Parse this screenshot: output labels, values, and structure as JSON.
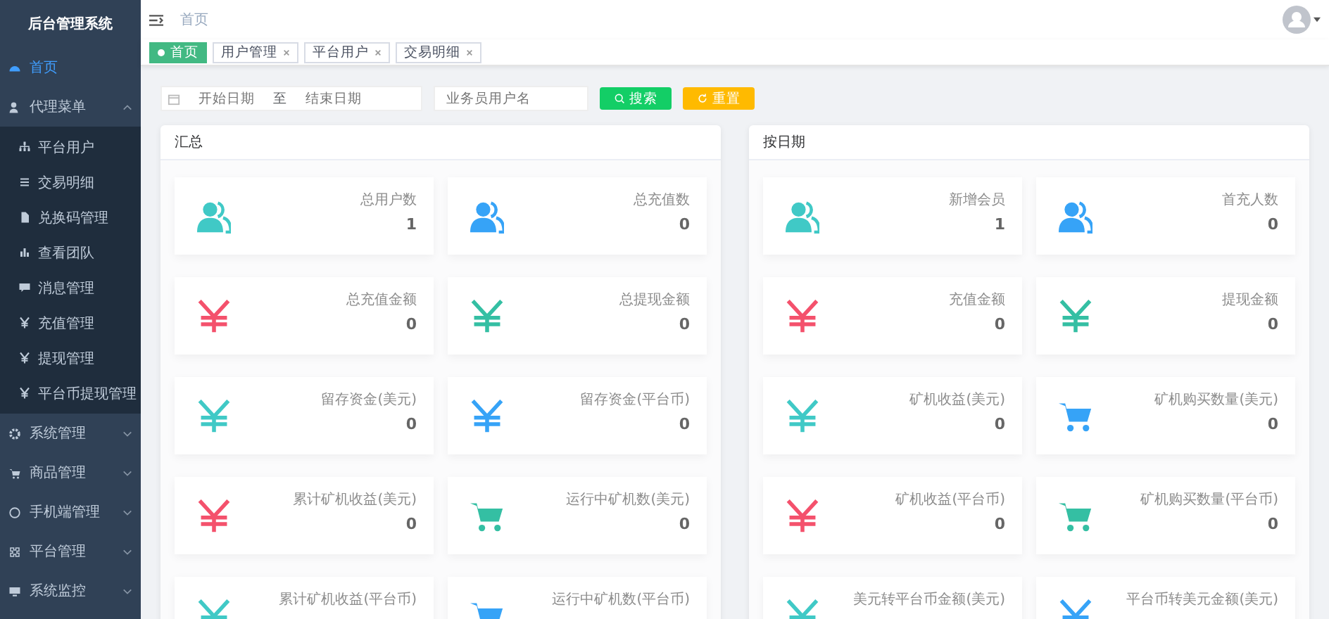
{
  "sidebar": {
    "title": "后台管理系统",
    "items": [
      {
        "label": "首页",
        "selected": true
      },
      {
        "label": "代理菜单",
        "selected": false,
        "expanded": true,
        "children": [
          {
            "label": "平台用户"
          },
          {
            "label": "交易明细"
          },
          {
            "label": "兑换码管理"
          },
          {
            "label": "查看团队"
          },
          {
            "label": "消息管理"
          },
          {
            "label": "充值管理"
          },
          {
            "label": "提现管理"
          },
          {
            "label": "平台币提现管理"
          }
        ]
      },
      {
        "label": "系统管理",
        "selected": false,
        "expanded": false
      },
      {
        "label": "商品管理",
        "selected": false,
        "expanded": false
      },
      {
        "label": "手机端管理",
        "selected": false,
        "expanded": false
      },
      {
        "label": "平台管理",
        "selected": false,
        "expanded": false
      },
      {
        "label": "系统监控",
        "selected": false,
        "expanded": false
      }
    ]
  },
  "breadcrumb": "首页",
  "tabs": [
    {
      "label": "首页",
      "selected": true,
      "closable": false
    },
    {
      "label": "用户管理",
      "selected": false,
      "closable": true
    },
    {
      "label": "平台用户",
      "selected": false,
      "closable": true
    },
    {
      "label": "交易明细",
      "selected": false,
      "closable": true
    }
  ],
  "filter": {
    "start_placeholder": "开始日期",
    "separator": "至",
    "end_placeholder": "结束日期",
    "user_placeholder": "业务员用户名",
    "search_button": "搜索",
    "reset_button": "重置"
  },
  "panels": [
    {
      "title": "汇总",
      "cards": [
        {
          "kind": "users",
          "color": "#40c9c6",
          "label": "总用户数",
          "value": "1"
        },
        {
          "kind": "users",
          "color": "#36a3f7",
          "label": "总充值数",
          "value": "0"
        },
        {
          "kind": "yen",
          "color": "#f4516c",
          "label": "总充值金额",
          "value": "0"
        },
        {
          "kind": "yen",
          "color": "#34bfa3",
          "label": "总提现金额",
          "value": "0"
        },
        {
          "kind": "yen",
          "color": "#40c9c6",
          "label": "留存资金(美元)",
          "value": "0"
        },
        {
          "kind": "yen",
          "color": "#36a3f7",
          "label": "留存资金(平台币)",
          "value": "0"
        },
        {
          "kind": "yen",
          "color": "#f4516c",
          "label": "累计矿机收益(美元)",
          "value": "0"
        },
        {
          "kind": "cart",
          "color": "#34bfa3",
          "label": "运行中矿机数(美元)",
          "value": "0"
        },
        {
          "kind": "yen",
          "color": "#40c9c6",
          "label": "累计矿机收益(平台币)"
        },
        {
          "kind": "cart",
          "color": "#36a3f7",
          "label": "运行中矿机数(平台币)"
        }
      ]
    },
    {
      "title": "按日期",
      "cards": [
        {
          "kind": "users",
          "color": "#40c9c6",
          "label": "新增会员",
          "value": "1"
        },
        {
          "kind": "users",
          "color": "#36a3f7",
          "label": "首充人数",
          "value": "0"
        },
        {
          "kind": "yen",
          "color": "#f4516c",
          "label": "充值金额",
          "value": "0"
        },
        {
          "kind": "yen",
          "color": "#34bfa3",
          "label": "提现金额",
          "value": "0"
        },
        {
          "kind": "yen",
          "color": "#40c9c6",
          "label": "矿机收益(美元)",
          "value": "0"
        },
        {
          "kind": "cart",
          "color": "#36a3f7",
          "label": "矿机购买数量(美元)",
          "value": "0"
        },
        {
          "kind": "yen",
          "color": "#f4516c",
          "label": "矿机收益(平台币)",
          "value": "0"
        },
        {
          "kind": "cart",
          "color": "#34bfa3",
          "label": "矿机购买数量(平台币)",
          "value": "0"
        },
        {
          "kind": "yen",
          "color": "#40c9c6",
          "label": "美元转平台币金额(美元)"
        },
        {
          "kind": "yen",
          "color": "#36a3f7",
          "label": "平台币转美元金额(美元)"
        }
      ]
    }
  ]
}
